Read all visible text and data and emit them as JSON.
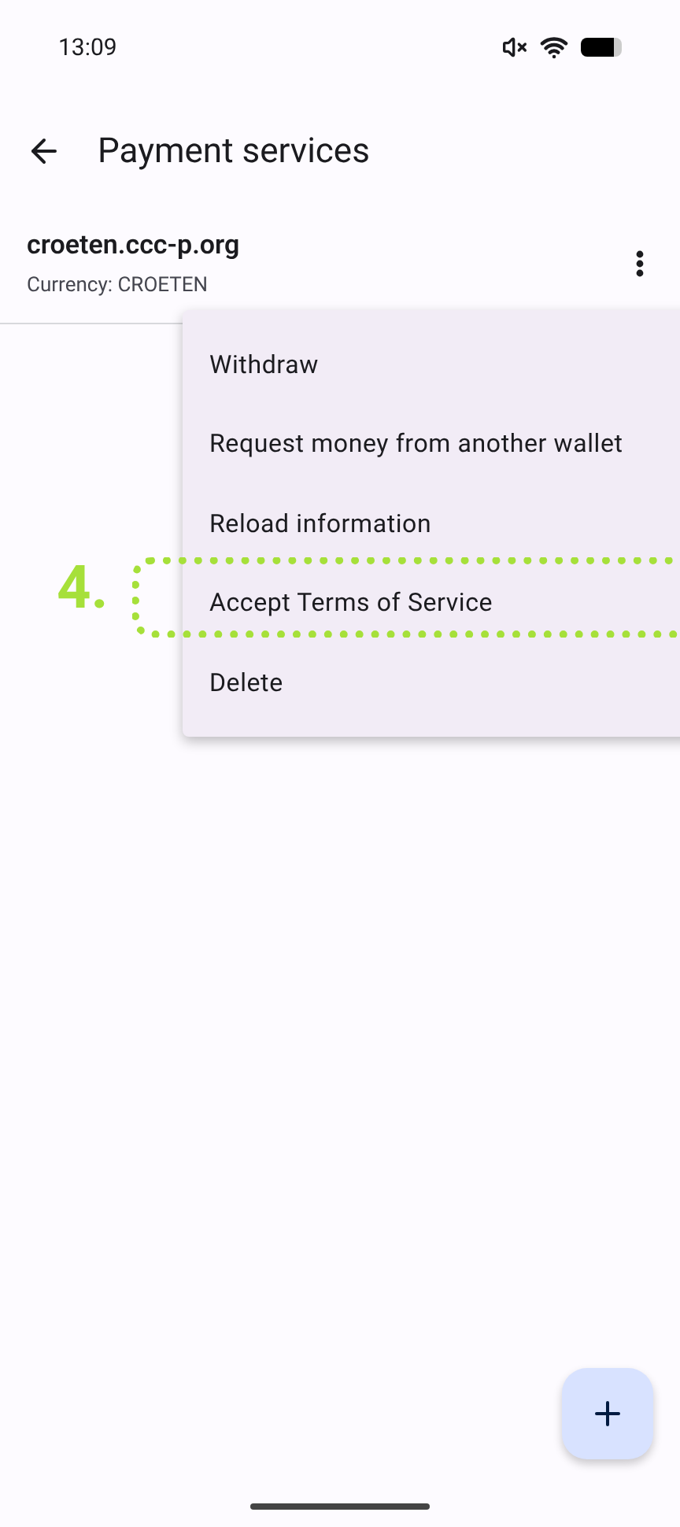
{
  "status_bar": {
    "time": "13:09"
  },
  "app_bar": {
    "title": "Payment services"
  },
  "exchange": {
    "name": "croeten.ccc-p.org",
    "currency": "Currency: CROETEN"
  },
  "menu": {
    "items": [
      {
        "label": "Withdraw",
        "highlighted": false
      },
      {
        "label": "Request money from another wallet",
        "highlighted": false
      },
      {
        "label": "Reload information",
        "highlighted": false
      },
      {
        "label": "Accept Terms of Service",
        "highlighted": true
      },
      {
        "label": "Delete",
        "highlighted": false
      }
    ]
  },
  "annotation": {
    "step": "4."
  }
}
